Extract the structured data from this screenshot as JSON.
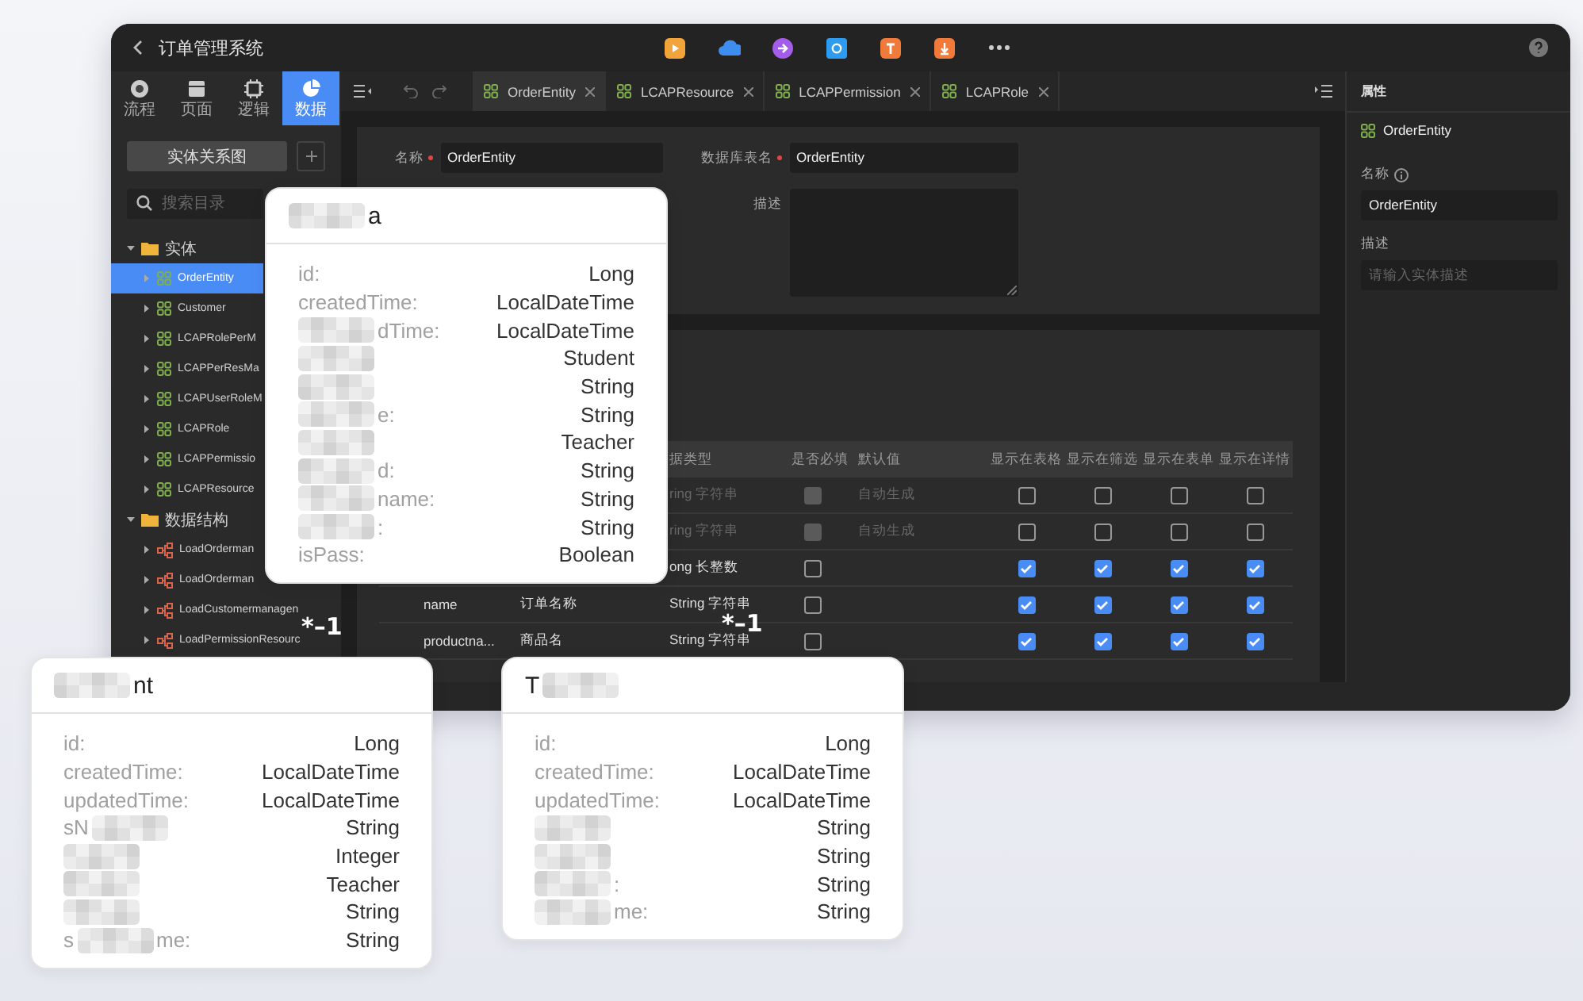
{
  "app": {
    "title": "订单管理系统"
  },
  "nav_tabs": [
    {
      "label": "流程",
      "selected": false
    },
    {
      "label": "页面",
      "selected": false
    },
    {
      "label": "逻辑",
      "selected": false
    },
    {
      "label": "数据",
      "selected": true
    }
  ],
  "sidebar": {
    "er_button": "实体关系图",
    "search": {
      "placeholder": "搜索目录"
    },
    "tree": [
      {
        "label": "实体",
        "kind": "folder",
        "expanded": true,
        "selected": false,
        "children": [
          {
            "label": "OrderEntity",
            "kind": "entity",
            "expanded": false,
            "selected": true
          },
          {
            "label": "Customer",
            "kind": "entity",
            "expanded": false,
            "selected": false
          },
          {
            "label": "LCAPRolePerM",
            "kind": "entity",
            "expanded": false,
            "selected": false
          },
          {
            "label": "LCAPPerResMa",
            "kind": "entity",
            "expanded": false,
            "selected": false
          },
          {
            "label": "LCAPUserRoleM",
            "kind": "entity",
            "expanded": false,
            "selected": false
          },
          {
            "label": "LCAPRole",
            "kind": "entity",
            "expanded": false,
            "selected": false
          },
          {
            "label": "LCAPPermissio",
            "kind": "entity",
            "expanded": false,
            "selected": false
          },
          {
            "label": "LCAPResource",
            "kind": "entity",
            "expanded": false,
            "selected": false
          }
        ]
      },
      {
        "label": "数据结构",
        "kind": "folder",
        "expanded": true,
        "selected": false,
        "children": [
          {
            "label": "LoadOrderman",
            "kind": "structure",
            "expanded": false,
            "selected": false
          },
          {
            "label": "LoadOrderman",
            "kind": "structure",
            "expanded": false,
            "selected": false
          },
          {
            "label": "LoadCustomermanagen",
            "kind": "structure",
            "expanded": false,
            "selected": false
          },
          {
            "label": "LoadPermissionResourc",
            "kind": "structure",
            "expanded": false,
            "selected": false
          }
        ]
      }
    ]
  },
  "editor_tabs": [
    {
      "label": "OrderEntity",
      "selected": true
    },
    {
      "label": "LCAPResource",
      "selected": false
    },
    {
      "label": "LCAPPermission",
      "selected": false
    },
    {
      "label": "LCAPRole",
      "selected": false
    }
  ],
  "form": {
    "name_label": "名称",
    "name_value": "OrderEntity",
    "table_label": "数据库表名",
    "table_value": "OrderEntity",
    "description_label": "描述"
  },
  "fields_table": {
    "columns": [
      "据类型",
      "是否必填",
      "默认值",
      "显示在表格",
      "显示在筛选",
      "显示在表单",
      "显示在详情"
    ],
    "rows": [
      {
        "disabled": true,
        "type": "ring 字符串",
        "required": false,
        "default": "自动生成",
        "flags": [
          false,
          false,
          false,
          false
        ]
      },
      {
        "disabled": true,
        "type": "ring 字符串",
        "required": false,
        "default": "自动生成",
        "flags": [
          false,
          false,
          false,
          false
        ]
      },
      {
        "disabled": false,
        "type": "ong 长整数",
        "required": false,
        "flags": [
          true,
          true,
          true,
          true
        ]
      },
      {
        "disabled": false,
        "name": "name",
        "label": "订单名称",
        "type": "String 字符串",
        "required": false,
        "flags": [
          true,
          true,
          true,
          true
        ]
      },
      {
        "disabled": false,
        "name": "productna...",
        "label": "商品名",
        "type": "String 字符串",
        "required": false,
        "flags": [
          true,
          true,
          true,
          true
        ]
      }
    ]
  },
  "properties": {
    "title": "属性",
    "entity": "OrderEntity",
    "name_label": "名称",
    "name_value": "OrderEntity",
    "description_label": "描述",
    "description_placeholder": "请输入实体描述"
  },
  "diagram": {
    "cards": [
      {
        "title": "a",
        "title_masked_before": true,
        "rows": [
          {
            "label": "id:",
            "value": "Long"
          },
          {
            "label": "createdTime:",
            "value": "LocalDateTime"
          },
          {
            "label": "dTime:",
            "masked_before": true,
            "value": "LocalDateTime"
          },
          {
            "masked_before": true,
            "value": "Student"
          },
          {
            "masked_before": true,
            "value": "String"
          },
          {
            "label": "e:",
            "masked_before": true,
            "value": "String"
          },
          {
            "masked_before": true,
            "value": "Teacher"
          },
          {
            "label": "d:",
            "masked_before": true,
            "value": "String"
          },
          {
            "label": "name:",
            "masked_before": true,
            "value": "String"
          },
          {
            "label": ":",
            "masked_before": true,
            "value": "String"
          },
          {
            "label": "isPass:",
            "value": "Boolean"
          }
        ]
      },
      {
        "title": "nt",
        "title_masked_before": true,
        "rows": [
          {
            "label": "id:",
            "value": "Long"
          },
          {
            "label": "createdTime:",
            "value": "LocalDateTime"
          },
          {
            "label": "updatedTime:",
            "value": "LocalDateTime"
          },
          {
            "label": "sN",
            "masked_after": true,
            "value": "String"
          },
          {
            "masked_before": true,
            "value": "Integer"
          },
          {
            "masked_before": true,
            "value": "Teacher"
          },
          {
            "masked_before": true,
            "value": "String"
          },
          {
            "label": "s",
            "masked_after": true,
            "label_tail": "me:",
            "value": "String"
          }
        ]
      },
      {
        "title": "T",
        "title_masked_after": true,
        "rows": [
          {
            "label": "id:",
            "value": "Long"
          },
          {
            "label": "createdTime:",
            "value": "LocalDateTime"
          },
          {
            "label": "updatedTime:",
            "value": "LocalDateTime"
          },
          {
            "masked_before": true,
            "value": "String"
          },
          {
            "masked_before": true,
            "value": "String"
          },
          {
            "label": ":",
            "masked_before": true,
            "value": "String"
          },
          {
            "label": "me:",
            "masked_before": true,
            "value": "String"
          }
        ]
      }
    ],
    "multiplicity_labels": [
      "*–1",
      "*–1"
    ]
  }
}
